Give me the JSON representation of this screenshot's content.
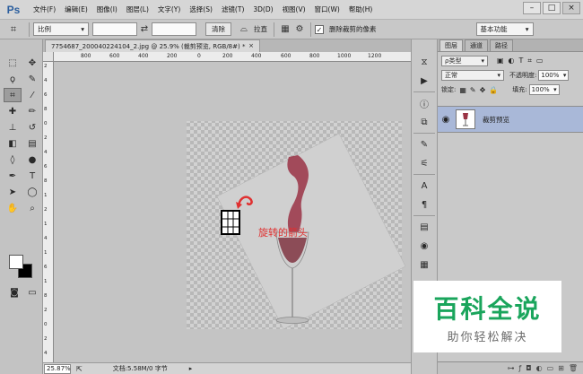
{
  "app": {
    "logo": "Ps"
  },
  "menu": [
    "文件(F)",
    "编辑(E)",
    "图像(I)",
    "图层(L)",
    "文字(Y)",
    "选择(S)",
    "滤镜(T)",
    "3D(D)",
    "视图(V)",
    "窗口(W)",
    "帮助(H)"
  ],
  "window_controls": {
    "minimize": "–",
    "maximize": "□",
    "close": "×"
  },
  "options": {
    "ratio_select": "比例",
    "clear_button": "清除",
    "straighten_label": "拉直",
    "delete_pixels_label": "删除裁剪的像素",
    "workspace": "基本功能"
  },
  "document": {
    "tab_title": "7754687_200040224104_2.jpg @ 25.9% (裁剪预览, RGB/8#) *",
    "tab_close": "×",
    "ruler_top": [
      "800",
      "600",
      "400",
      "200",
      "0",
      "200",
      "400",
      "600",
      "800",
      "1000",
      "1200"
    ],
    "ruler_left": [
      "2",
      "4",
      "6",
      "8",
      "0",
      "2",
      "4",
      "6",
      "8",
      "1",
      "2",
      "1",
      "4",
      "1",
      "6",
      "1",
      "8",
      "2",
      "0",
      "2",
      "4"
    ],
    "zoom": "25.87%",
    "status": "文档:5.58M/0 字节",
    "annotation": "旋转的箭头"
  },
  "layers": {
    "tabs": [
      "图层",
      "通道",
      "路径"
    ],
    "filter_label": "ρ类型",
    "blend_mode": "正常",
    "opacity_label": "不透明度:",
    "opacity": "100%",
    "lock_label": "锁定:",
    "fill_label": "填充:",
    "fill": "100%",
    "items": [
      {
        "name": "裁剪预览"
      }
    ]
  },
  "watermark": {
    "title": "百科全说",
    "subtitle": "助你轻松解决"
  },
  "colors": {
    "accent": "#1aa55c",
    "selection": "#a9b8d8",
    "annotation": "#e03030"
  }
}
